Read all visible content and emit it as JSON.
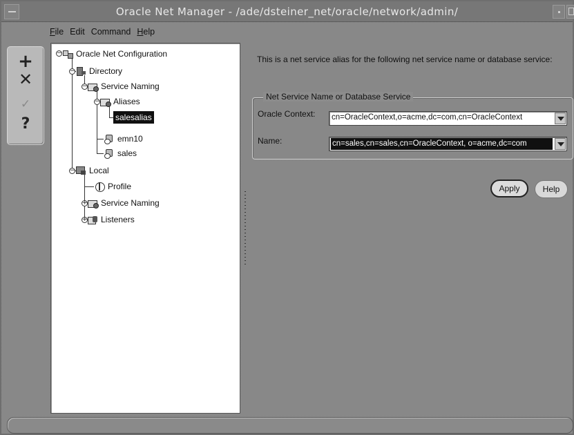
{
  "window": {
    "title": "Oracle Net Manager - /ade/dsteiner_net/oracle/network/admin/"
  },
  "menu": {
    "items": [
      {
        "label": "File",
        "mnemonic": "F"
      },
      {
        "label": "Edit",
        "mnemonic": ""
      },
      {
        "label": "Command",
        "mnemonic": ""
      },
      {
        "label": "Help",
        "mnemonic": "H"
      }
    ]
  },
  "toolbar": {
    "add_icon": "plus-icon",
    "delete_icon": "x-icon",
    "test_icon": "check-icon",
    "help_icon": "question-icon",
    "add_glyph": "+",
    "delete_glyph": "✕",
    "test_glyph": "✓",
    "help_glyph": "?"
  },
  "tree": {
    "root": "Oracle Net Configuration",
    "directory": "Directory",
    "dir_service_naming": "Service Naming",
    "aliases": "Aliases",
    "salesalias": "salesalias",
    "emn10": "emn10",
    "sales": "sales",
    "local": "Local",
    "profile": "Profile",
    "local_service_naming": "Service Naming",
    "listeners": "Listeners"
  },
  "content": {
    "description": "This is a net service alias for the following net service name or database service:",
    "group_title": "Net Service Name or Database Service",
    "oracle_context_label": "Oracle Context:",
    "oracle_context_value": "cn=OracleContext,o=acme,dc=com,cn=OracleContext",
    "name_label": "Name:",
    "name_value": "cn=sales,cn=sales,cn=OracleContext, o=acme,dc=com",
    "apply_label": "Apply",
    "help_label": "Help"
  },
  "colors": {
    "background": "#8c8c8c",
    "selection": "#101010",
    "panel": "#ffffff"
  }
}
